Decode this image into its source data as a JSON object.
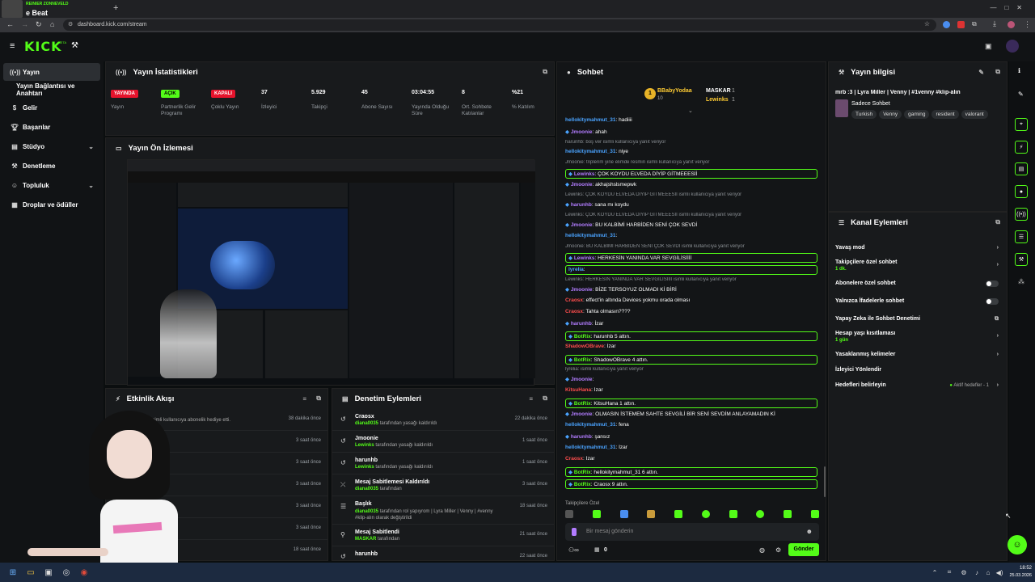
{
  "browser": {
    "tab_title": "e Beat",
    "tab_overlay_label": "REINIER ZONNEVELD",
    "new_tab_icon": "+",
    "url": "dashboard.kick.com/stream"
  },
  "kick": {
    "logo": "KICK",
    "logo_badge": "BETA"
  },
  "sidebar": {
    "items": [
      {
        "label": "Yayın",
        "icon": "broadcast-icon",
        "active": true
      },
      {
        "label": "Yayın Bağlantısı ve Anahtarı",
        "icon": "",
        "active": false
      },
      {
        "label": "Gelir",
        "icon": "dollar-icon",
        "active": false
      },
      {
        "label": "Başarılar",
        "icon": "trophy-icon",
        "active": false
      },
      {
        "label": "Stüdyo",
        "icon": "studio-icon",
        "active": false,
        "chevron": true
      },
      {
        "label": "Denetleme",
        "icon": "gavel-icon",
        "active": false
      },
      {
        "label": "Topluluk",
        "icon": "community-icon",
        "active": false,
        "chevron": true
      },
      {
        "label": "Droplar ve ödüller",
        "icon": "gift-icon",
        "active": false
      }
    ]
  },
  "stats": {
    "title": "Yayın İstatistikleri",
    "items": [
      {
        "value": "YAYINDA",
        "label": "Yayın",
        "badge": "red"
      },
      {
        "value": "AÇIK",
        "label": "Partnerlik Gelir Programı",
        "badge": "green"
      },
      {
        "value": "KAPALI",
        "label": "Çoklu Yayın",
        "badge": "red"
      },
      {
        "value": "37",
        "label": "İzleyici"
      },
      {
        "value": "5.929",
        "label": "Takipçi"
      },
      {
        "value": "45",
        "label": "Abone Sayısı"
      },
      {
        "value": "03:04:55",
        "label": "Yayında Olduğu Süre"
      },
      {
        "value": "8",
        "label": "Ort. Sohbete Katılanlar"
      },
      {
        "value": "%21",
        "label": "% Katılım"
      }
    ]
  },
  "preview": {
    "title": "Yayın Ön İzlemesi"
  },
  "activity": {
    "title": "Etkinlik Akışı",
    "rows": [
      {
        "text": "isimli kullanıcıya abonelik hediye etti.",
        "time": "38 dakika önce"
      },
      {
        "text": "etti",
        "time": "3 saat önce"
      },
      {
        "text": "etti",
        "time": "3 saat önce"
      },
      {
        "text": "",
        "time": "3 saat önce"
      },
      {
        "text": "",
        "time": "3 saat önce"
      },
      {
        "text": "",
        "time": "3 saat önce"
      },
      {
        "text": "",
        "time": "18 saat önce"
      }
    ]
  },
  "moderation": {
    "title": "Denetim Eylemleri",
    "rows": [
      {
        "title": "Craosx",
        "by": "diana0035",
        "action": "tarafından yasağı kaldırıldı",
        "time": "22 dakika önce",
        "icon": "unban-icon"
      },
      {
        "title": "Jmoonie",
        "by": "Lewinks",
        "action": "tarafından yasağı kaldırıldı",
        "time": "1 saat önce",
        "icon": "unban-icon"
      },
      {
        "title": "harunhb",
        "by": "Lewinks",
        "action": "tarafından yasağı kaldırıldı",
        "time": "1 saat önce",
        "icon": "unban-icon"
      },
      {
        "title": "Mesaj Sabitlemesi Kaldırıldı",
        "by": "diana0035",
        "action": "tarafından",
        "time": "3 saat önce",
        "icon": "unpin-icon"
      },
      {
        "title": "Başlık",
        "by": "diana0035",
        "action": "tarafından rol yapıyrom | Lyra Miller | Venny | #venny #klip-alın olarak değiştirildi",
        "time": "18 saat önce",
        "icon": "title-icon"
      },
      {
        "title": "Mesaj Sabitlendi",
        "by": "MASKAR",
        "action": "tarafından",
        "time": "21 saat önce",
        "icon": "pin-icon"
      },
      {
        "title": "harunhb",
        "by": "",
        "action": "",
        "time": "22 saat önce",
        "icon": "unban-icon"
      }
    ]
  },
  "chat": {
    "title": "Sohbet",
    "top_gifters": [
      {
        "name": "BBabyYodaa",
        "count": "10"
      },
      {
        "name": "MASKAR",
        "count": "1"
      },
      {
        "name": "Lewinks",
        "count": "1"
      }
    ],
    "messages": [
      {
        "user": "hellokitymahmut_31",
        "text": "hadiiii",
        "color": "blue"
      },
      {
        "user": "Jmoonie",
        "text": "ahah",
        "color": "purple"
      },
      {
        "reply": "harunhb: boş ver isimli kullanıcıya yanıt veriyor"
      },
      {
        "user": "hellokitymahmut_31",
        "text": "niye",
        "color": "blue"
      },
      {
        "reply": "Jmoonie: triplerim yine elimde resmin isimli kullanıcıya yanıt veriyor"
      },
      {
        "user": "Lewinks",
        "text": "ÇOK KOYDU ELVEDA DİYİP GİTMEEESİİ",
        "color": "purple",
        "box": true
      },
      {
        "user": "Jmoonie",
        "text": "akhajshslsmepwk",
        "color": "purple"
      },
      {
        "reply": "Lewinks: ÇOK KOYDU ELVEDA DİYİP GİTMEEESİİ isimli kullanıcıya yanıt veriyor"
      },
      {
        "user": "harunhb",
        "text": "sana mı koydu",
        "color": "purple"
      },
      {
        "reply": "Lewinks: ÇOK KOYDU ELVEDA DİYİP GİTMEEESİİ isimli kullanıcıya yanıt veriyor"
      },
      {
        "user": "Jmoonie",
        "text": "BU KALBİMİ HARBİDEN SENİ ÇOK SEVDİ",
        "color": "purple"
      },
      {
        "user": "hellokitymahmut_31",
        "text": "",
        "color": "blue"
      },
      {
        "reply": "Jmoonie: BU KALBİMİ HARBİDEN SENİ ÇOK SEVDİ isimli kullanıcıya yanıt veriyor"
      },
      {
        "user": "Lewinks",
        "text": "HERKESİN YANINDA VAR SEVGİLİSİİİİ",
        "color": "purple",
        "box": true
      },
      {
        "user": "lyrelia",
        "text": "",
        "color": "blue",
        "box": true
      },
      {
        "reply": "Lewinks: HERKESİN YANINDA VAR SEVGİLİSİİİİ isimli kullanıcıya yanıt veriyor"
      },
      {
        "user": "Jmoonie",
        "text": "BİZE TERSOYUZ OLMADI Kİ BİRİ",
        "color": "purple"
      },
      {
        "user": "Craosx",
        "text": "effect'in altında Devices yokmu orada olması",
        "color": "red"
      },
      {
        "user": "Craosx",
        "text": "Tahta olmasın????",
        "color": "red"
      },
      {
        "user": "harunhb",
        "text": "İzar",
        "color": "purple"
      },
      {
        "user": "BotRix",
        "text": "harunhb 5 attın.",
        "color": "green",
        "box": true
      },
      {
        "user": "ShadowOBrave",
        "text": "İzar",
        "color": "red"
      },
      {
        "user": "BotRix",
        "text": "ShadowOBrave 4 attın.",
        "color": "green",
        "box": true
      },
      {
        "reply": "lyrelia: isimli kullanıcıya yanıt veriyor"
      },
      {
        "user": "Jmoonie",
        "text": "",
        "color": "purple"
      },
      {
        "user": "KitsuHana",
        "text": "İzar",
        "color": "red"
      },
      {
        "user": "BotRix",
        "text": "KitsuHana 1 attın.",
        "color": "green",
        "box": true
      },
      {
        "user": "Jmoonie",
        "text": "OLMASIN İSTEMEM SAHTE SEVGİLİ BİR SENİ SEVDİM ANLAYAMADIN Kİ",
        "color": "purple"
      },
      {
        "user": "hellokitymahmut_31",
        "text": "fena",
        "color": "blue"
      },
      {
        "user": "harunhb",
        "text": "şansız",
        "color": "purple"
      },
      {
        "user": "hellokitymahmut_31",
        "text": "İzar",
        "color": "blue"
      },
      {
        "user": "Craosx",
        "text": "İzar",
        "color": "red"
      },
      {
        "user": "BotRix",
        "text": "hellokitymahmut_31 6 attın.",
        "color": "green",
        "box": true
      },
      {
        "user": "BotRix",
        "text": "Craosx 9 attın.",
        "color": "green",
        "box": true
      }
    ],
    "followers_only_label": "Takipçilere Özel",
    "input_placeholder": "Bir mesaj gönderin",
    "send_label": "Gönder",
    "points": "0"
  },
  "stream_info": {
    "title": "Yayın bilgisi",
    "stream_title": "mrb :3 | Lyra Miller | Venny | #1venny #klip-alın",
    "category": "Sadece Sohbet",
    "tags": [
      "Turkish",
      "Venny",
      "gaming",
      "resident",
      "valorant"
    ]
  },
  "channel_actions": {
    "title": "Kanal Eylemleri",
    "rows": [
      {
        "label": "Yavaş mod",
        "kind": "chevron"
      },
      {
        "label": "Takipçilere özel sohbet",
        "sub": "1 dk.",
        "kind": "chevron"
      },
      {
        "label": "Abonelere özel sohbet",
        "kind": "toggle"
      },
      {
        "label": "Yalnızca İfadelerle sohbet",
        "kind": "toggle"
      },
      {
        "label": "Yapay Zeka ile Sohbet Denetimi",
        "kind": "external"
      },
      {
        "label": "Hesap yaşı kısıtlaması",
        "sub": "1 gün",
        "kind": "chevron"
      },
      {
        "label": "Yasaklanmış kelimeler",
        "kind": "chevron"
      },
      {
        "label": "İzleyici Yönlendir",
        "kind": "none"
      },
      {
        "label": "Hedefleri belirleyin",
        "kind": "chevron",
        "extra": "Aktif hedefler - 1"
      }
    ]
  },
  "taskbar": {
    "time": "18:52",
    "date": "25.03.2026"
  },
  "colors": {
    "accent": "#53fc18",
    "live": "#e5132c",
    "bg": "#0b0e0f",
    "panel": "#181a1c"
  }
}
